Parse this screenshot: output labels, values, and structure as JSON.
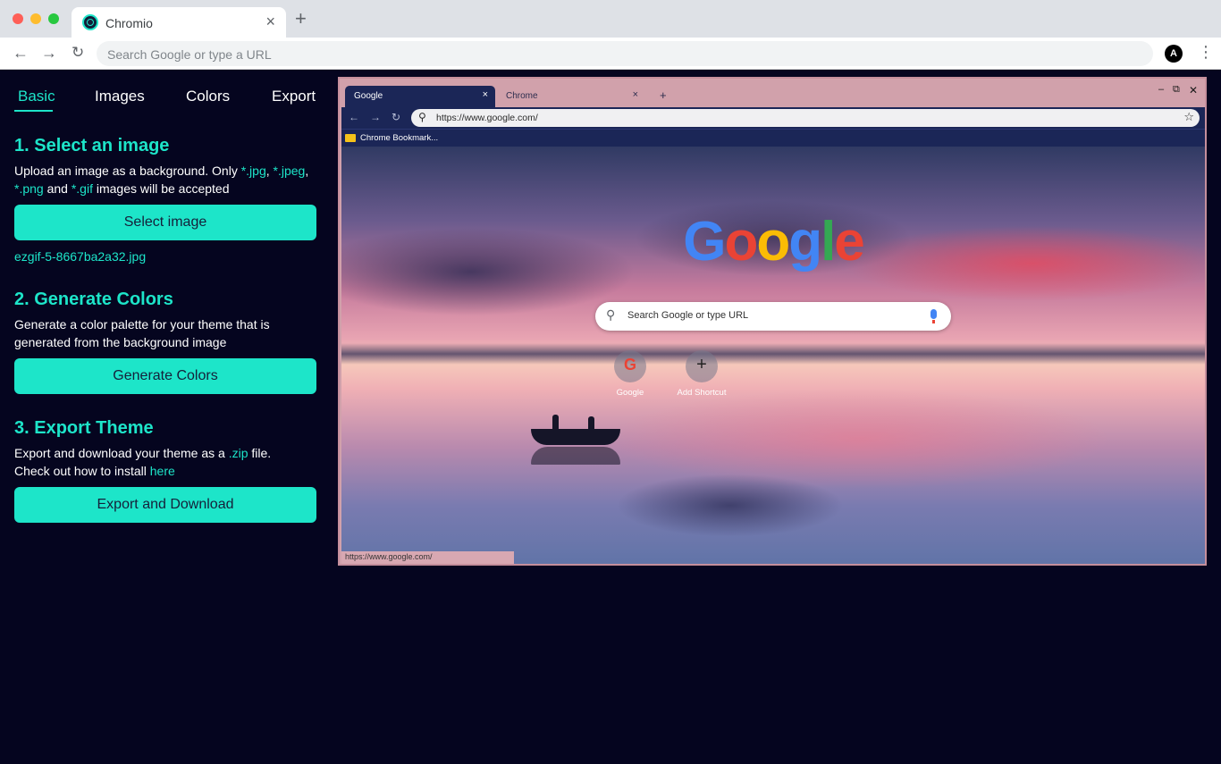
{
  "browser": {
    "tab_title": "Chromio",
    "tab_close": "×",
    "new_tab": "+",
    "omnibox_placeholder": "Search Google or type a URL",
    "avatar_letter": "A",
    "nav": {
      "back": "←",
      "forward": "→",
      "reload": "↻",
      "menu": "⋮"
    }
  },
  "panel": {
    "tabs": [
      "Basic",
      "Images",
      "Colors",
      "Export"
    ],
    "active_tab": "Basic",
    "accent_color": "#1de5c9",
    "background_color": "#05051f",
    "sections": {
      "select": {
        "heading": "1. Select an image",
        "text_1": "Upload an image as a background. Only ",
        "ext_jpg": "*.jpg",
        "sep_1": ", ",
        "ext_jpeg": "*.jpeg",
        "sep_2": ",",
        "ext_png": "*.png",
        "sep_3": " and ",
        "ext_gif": "*.gif",
        "text_2": " images will be accepted",
        "button": "Select image",
        "filename": "ezgif-5-8667ba2a32.jpg"
      },
      "generate": {
        "heading": "2. Generate Colors",
        "text": "Generate a color palette for your theme that is generated from the background image",
        "button": "Generate Colors"
      },
      "export": {
        "heading": "3. Export Theme",
        "text_1": "Export and download your theme as a ",
        "ext_zip": ".zip",
        "text_2": " file.",
        "text_3": "Check out how to install ",
        "link_here": "here",
        "button": "Export and Download"
      }
    }
  },
  "preview": {
    "active_tab": "Google",
    "inactive_tab": "Chrome",
    "tab_close": "×",
    "new_tab": "+",
    "window_controls": {
      "minimize": "–",
      "maximize": "⧉",
      "close": "✕"
    },
    "url": "https://www.google.com/",
    "bookmark": "Chrome Bookmark...",
    "logo_letters": [
      "G",
      "o",
      "o",
      "g",
      "l",
      "e"
    ],
    "search_placeholder": "Search Google or type URL",
    "shortcuts": [
      {
        "label": "Google",
        "icon": "G"
      },
      {
        "label": "Add Shortcut",
        "icon": "+"
      }
    ],
    "status_url": "https://www.google.com/",
    "frame_color": "#d1a1ab",
    "toolbar_color": "#1b2657"
  }
}
